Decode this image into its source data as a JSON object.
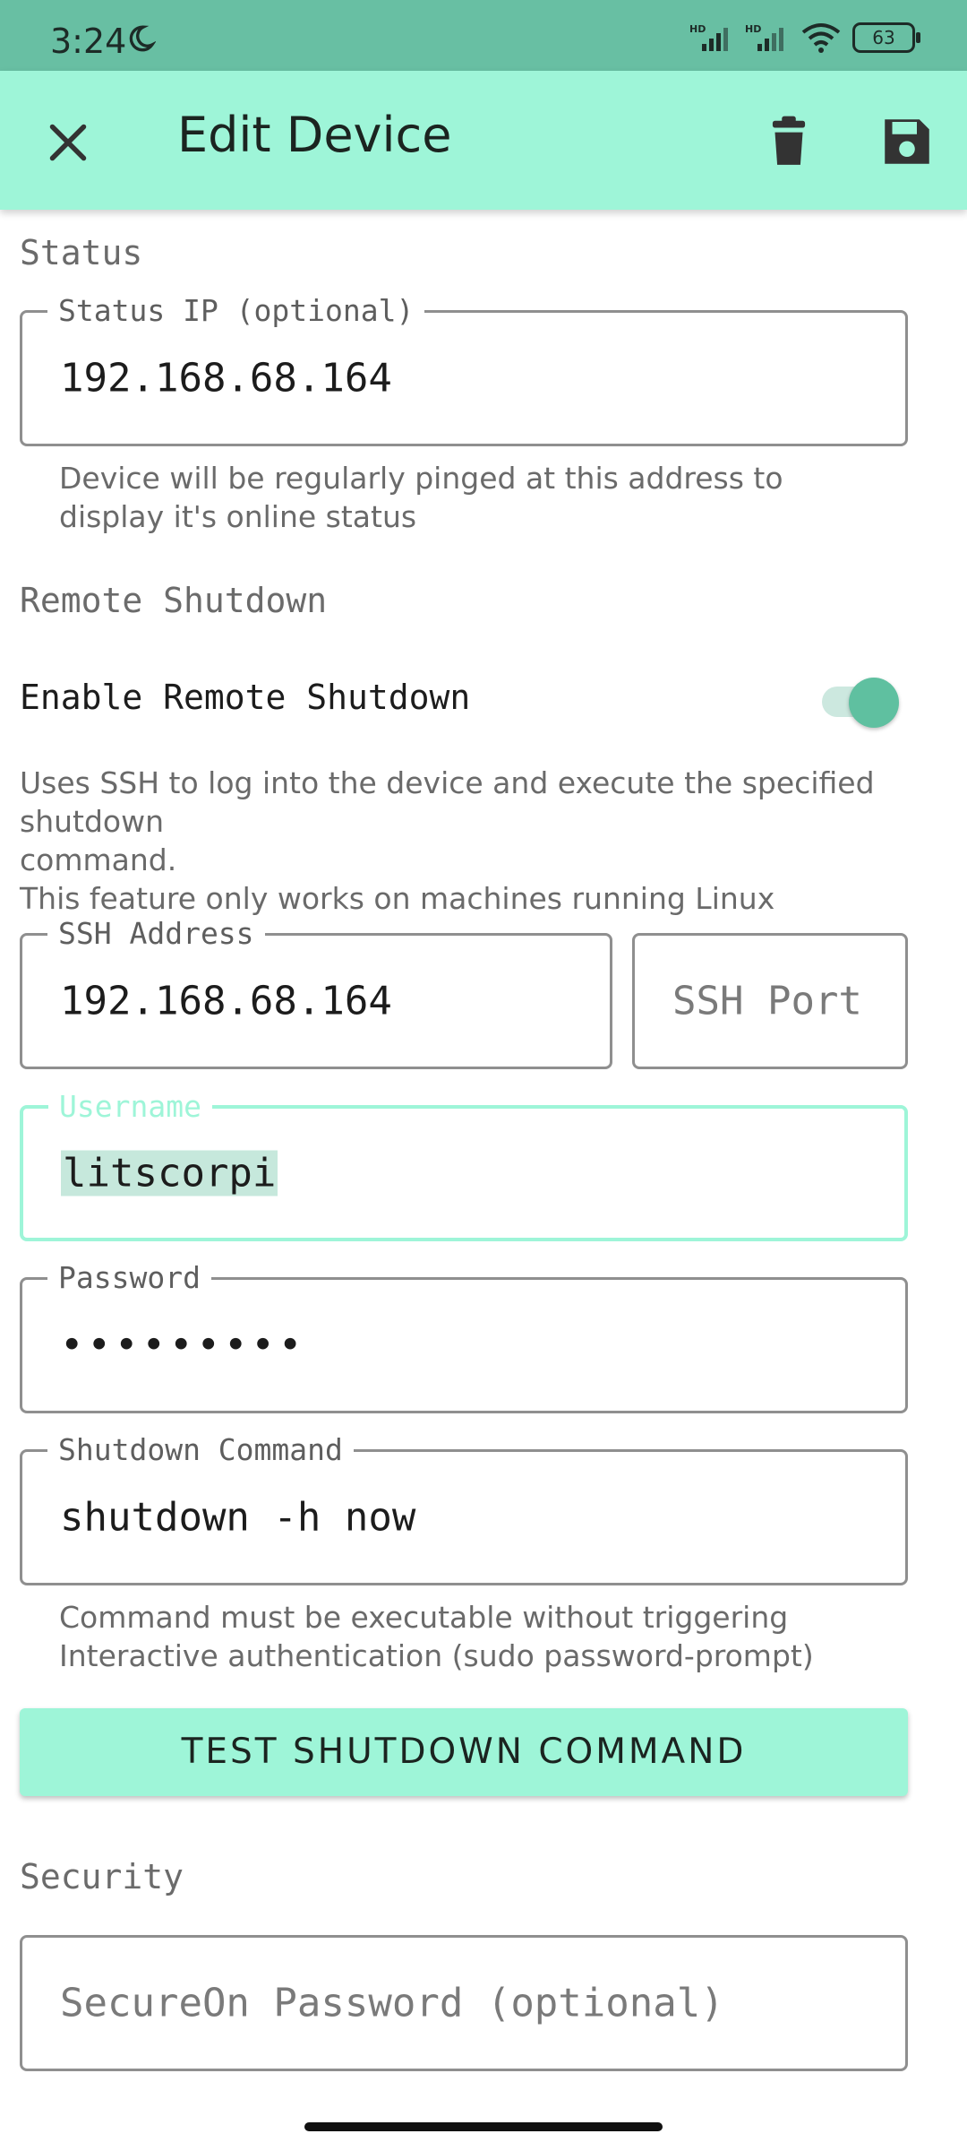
{
  "status_bar": {
    "time": "3:24",
    "battery": "63"
  },
  "app_bar": {
    "title": "Edit Device"
  },
  "status_section": {
    "header": "Status",
    "status_ip_label": "Status IP (optional)",
    "status_ip_value": "192.168.68.164",
    "status_ip_helper_line1": "Device will be regularly pinged at this address to",
    "status_ip_helper_line2": "display it's online status"
  },
  "shutdown_section": {
    "header": "Remote Shutdown",
    "enable_label": "Enable Remote Shutdown",
    "enabled": true,
    "desc_line1": "Uses SSH to log into the device and execute the specified shutdown",
    "desc_line2": "command.",
    "desc_line3": "This feature only works on machines running Linux",
    "ssh_address_label": "SSH Address",
    "ssh_address_value": "192.168.68.164",
    "ssh_port_placeholder": "SSH Port",
    "username_label": "Username",
    "username_value": "litscorpi",
    "password_label": "Password",
    "password_value": "•••••••••",
    "command_label": "Shutdown Command",
    "command_value": "shutdown -h now",
    "command_helper_line1": "Command must be executable without triggering",
    "command_helper_line2": "Interactive authentication (sudo password-prompt)",
    "test_button": "TEST SHUTDOWN COMMAND"
  },
  "security_section": {
    "header": "Security",
    "secureon_placeholder": "SecureOn Password (optional)"
  },
  "colors": {
    "accent": "#9ef5d8",
    "status_bar": "#68bfa3",
    "switch": "#5fc0a0"
  }
}
